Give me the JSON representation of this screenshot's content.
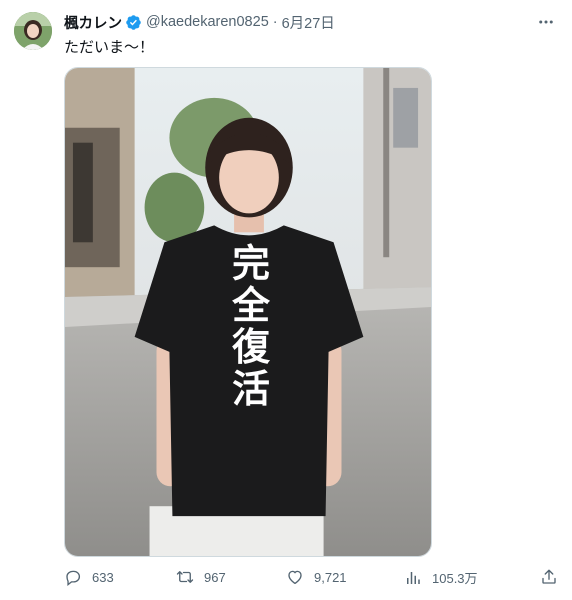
{
  "author": {
    "display_name": "楓カレン",
    "handle": "@kaedekaren0825",
    "separator": "·",
    "date": "6月27日",
    "verified": true,
    "verified_color": "#1d9bf0"
  },
  "tweet": {
    "text": "ただいま〜！",
    "media": {
      "shirt_text": "完全復活",
      "icon": "photo"
    }
  },
  "actions": {
    "reply_count": "633",
    "retweet_count": "967",
    "like_count": "9,721",
    "view_count": "105.3万"
  },
  "icons": {
    "more": "more-icon",
    "reply": "reply-icon",
    "retweet": "retweet-icon",
    "like": "heart-icon",
    "views": "views-icon",
    "share": "share-icon"
  }
}
